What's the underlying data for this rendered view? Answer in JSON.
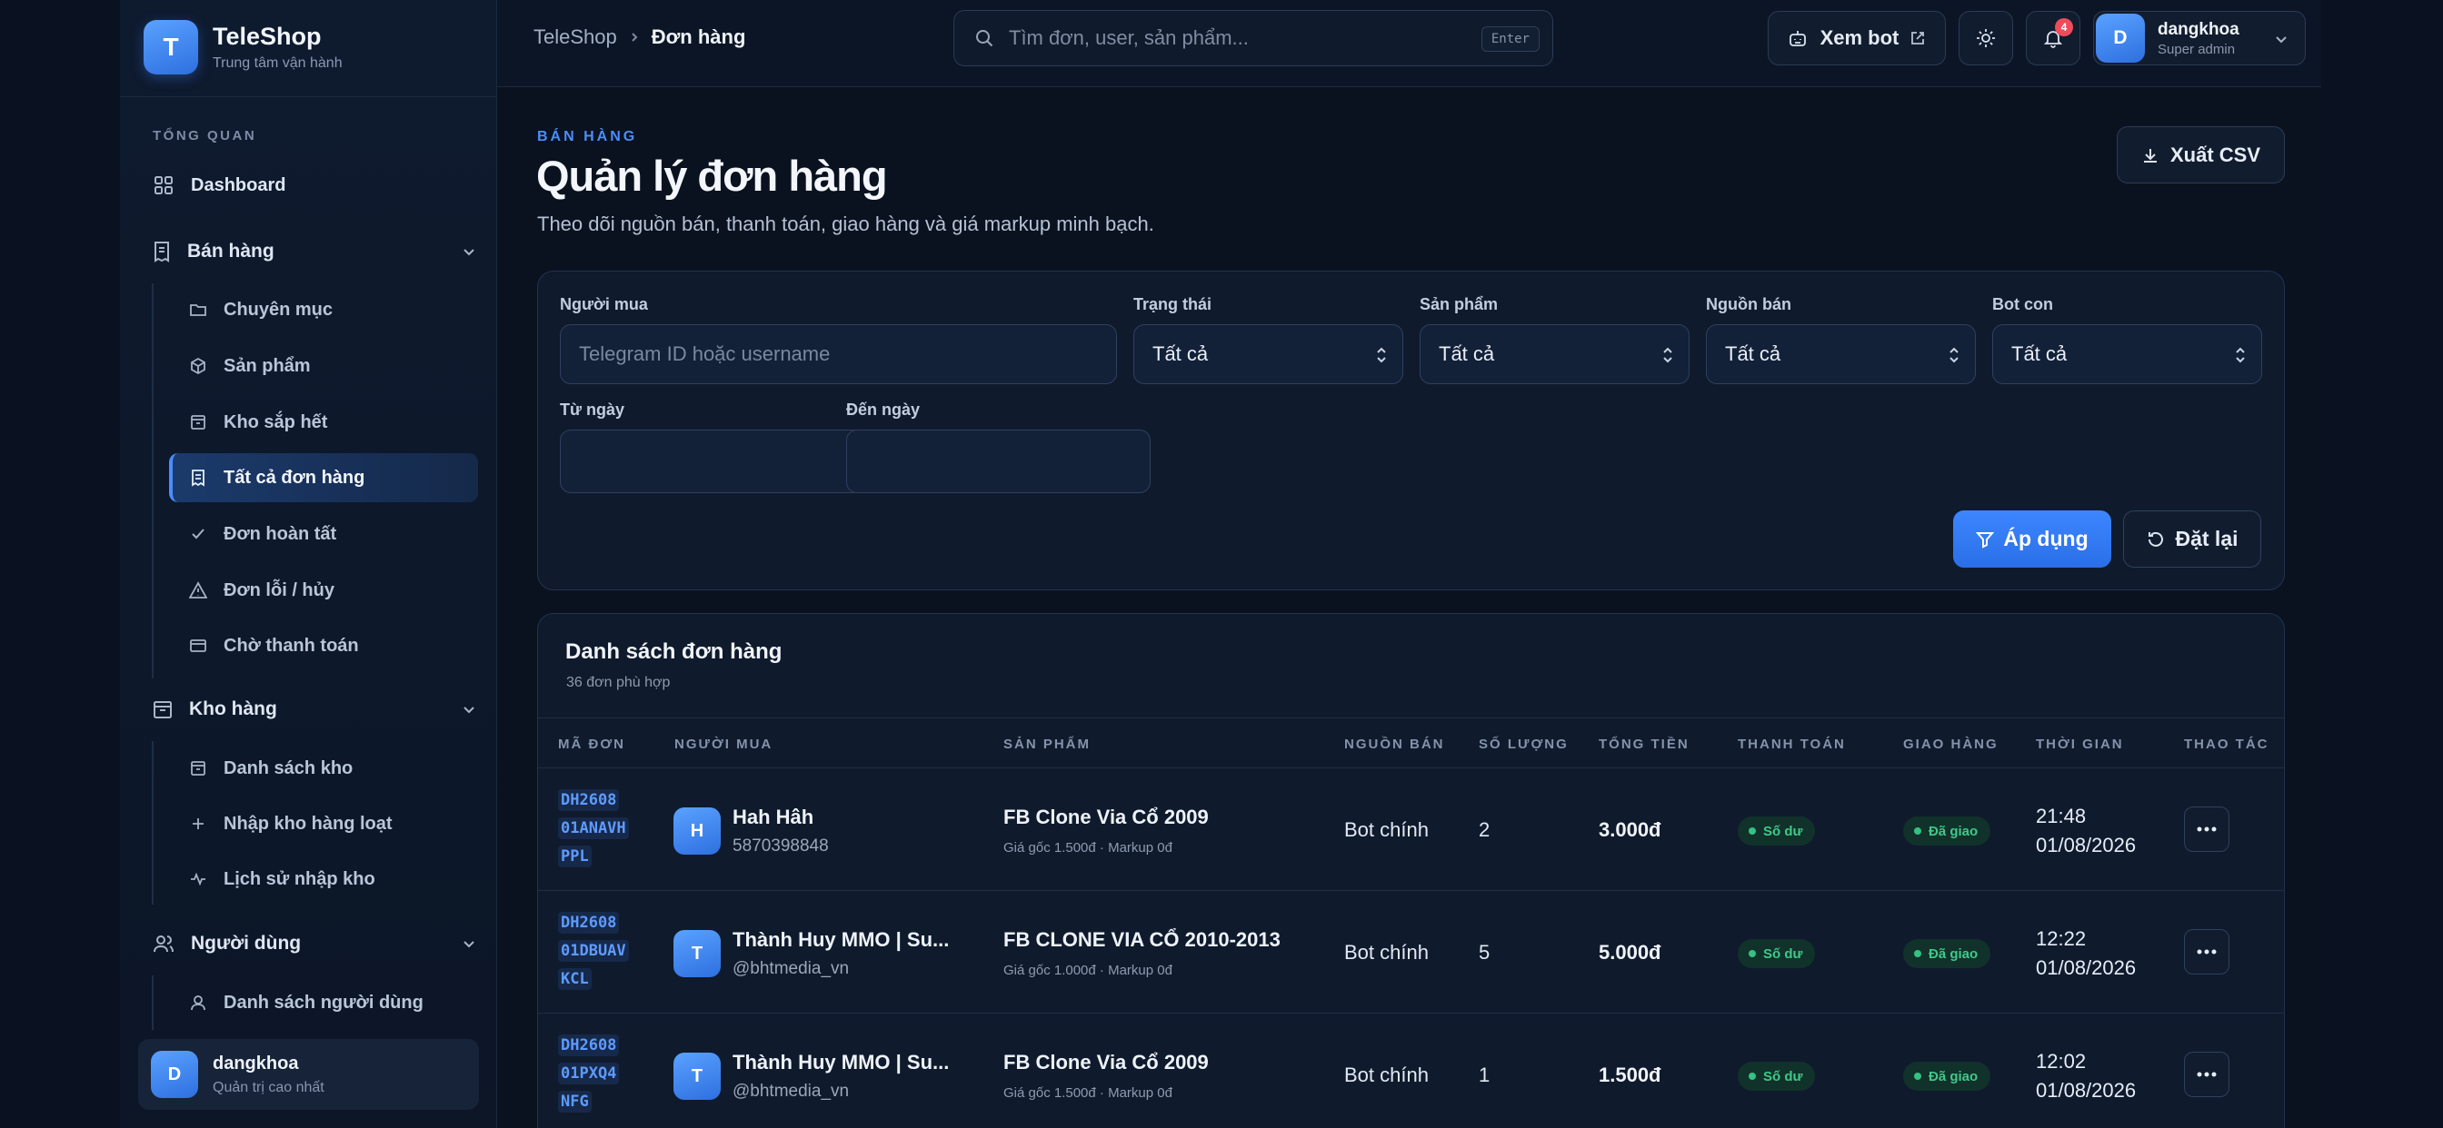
{
  "brand": {
    "logo": "T",
    "name": "TeleShop",
    "subtitle": "Trung tâm vận hành"
  },
  "sidebar": {
    "section": "TỔNG QUAN",
    "dashboard": "Dashboard",
    "ban_hang": {
      "label": "Bán hàng",
      "items": [
        "Chuyên mục",
        "Sản phẩm",
        "Kho sắp hết",
        "Tất cả đơn hàng",
        "Đơn hoàn tất",
        "Đơn lỗi / hủy",
        "Chờ thanh toán"
      ]
    },
    "kho_hang": {
      "label": "Kho hàng",
      "items": [
        "Danh sách kho",
        "Nhập kho hàng loạt",
        "Lịch sử nhập kho"
      ]
    },
    "nguoi_dung": {
      "label": "Người dùng",
      "items": [
        "Danh sách người dùng"
      ]
    },
    "user": {
      "initial": "D",
      "name": "dangkhoa",
      "role": "Quản trị cao nhất"
    }
  },
  "topbar": {
    "breadcrumb": [
      "TeleShop",
      "Đơn hàng"
    ],
    "search_placeholder": "Tìm đơn, user, sản phẩm...",
    "search_key": "Enter",
    "view_bot": "Xem bot",
    "notification_count": "4",
    "profile": {
      "initial": "D",
      "name": "dangkhoa",
      "role": "Super admin"
    }
  },
  "page": {
    "eyebrow": "BÁN HÀNG",
    "title": "Quản lý đơn hàng",
    "description": "Theo dõi nguồn bán, thanh toán, giao hàng và giá markup minh bạch.",
    "export": "Xuất CSV"
  },
  "filters": {
    "buyer_label": "Người mua",
    "buyer_placeholder": "Telegram ID hoặc username",
    "status_label": "Trạng thái",
    "status_value": "Tất cả",
    "product_label": "Sản phẩm",
    "product_value": "Tất cả",
    "source_label": "Nguồn bán",
    "source_value": "Tất cả",
    "bot_label": "Bot con",
    "bot_value": "Tất cả",
    "from_label": "Từ ngày",
    "to_label": "Đến ngày",
    "apply": "Áp dụng",
    "reset": "Đặt lại"
  },
  "orders": {
    "title": "Danh sách đơn hàng",
    "count": "36 đơn phù hợp",
    "columns": [
      "MÃ ĐƠN",
      "NGƯỜI MUA",
      "SẢN PHẨM",
      "NGUỒN BÁN",
      "SỐ LƯỢNG",
      "TỔNG TIỀN",
      "THANH TOÁN",
      "GIAO HÀNG",
      "THỜI GIAN",
      "THAO TÁC"
    ],
    "rows": [
      {
        "code": [
          "DH2608",
          "01ANAVH",
          "PPL"
        ],
        "buyer_initial": "H",
        "buyer_name": "Hah Hâh",
        "buyer_id": "5870398848",
        "product": "FB Clone Via Cổ 2009",
        "product_meta": "Giá gốc 1.500đ · Markup 0đ",
        "source": "Bot chính",
        "qty": "2",
        "total": "3.000đ",
        "payment": "Số dư",
        "delivery": "Đã giao",
        "time": "21:48",
        "date": "01/08/2026"
      },
      {
        "code": [
          "DH2608",
          "01DBUAV",
          "KCL"
        ],
        "buyer_initial": "T",
        "buyer_name": "Thành Huy MMO | Su...",
        "buyer_id": "@bhtmedia_vn",
        "product": "FB CLONE VIA CỔ 2010-2013",
        "product_meta": "Giá gốc 1.000đ · Markup 0đ",
        "source": "Bot chính",
        "qty": "5",
        "total": "5.000đ",
        "payment": "Số dư",
        "delivery": "Đã giao",
        "time": "12:22",
        "date": "01/08/2026"
      },
      {
        "code": [
          "DH2608",
          "01PXQ4",
          "NFG"
        ],
        "buyer_initial": "T",
        "buyer_name": "Thành Huy MMO | Su...",
        "buyer_id": "@bhtmedia_vn",
        "product": "FB Clone Via Cổ 2009",
        "product_meta": "Giá gốc 1.500đ · Markup 0đ",
        "source": "Bot chính",
        "qty": "1",
        "total": "1.500đ",
        "payment": "Số dư",
        "delivery": "Đã giao",
        "time": "12:02",
        "date": "01/08/2026"
      }
    ]
  },
  "colors": {
    "accent": "#3d86ff",
    "success": "#40c98a",
    "danger": "#ef4b5a"
  }
}
